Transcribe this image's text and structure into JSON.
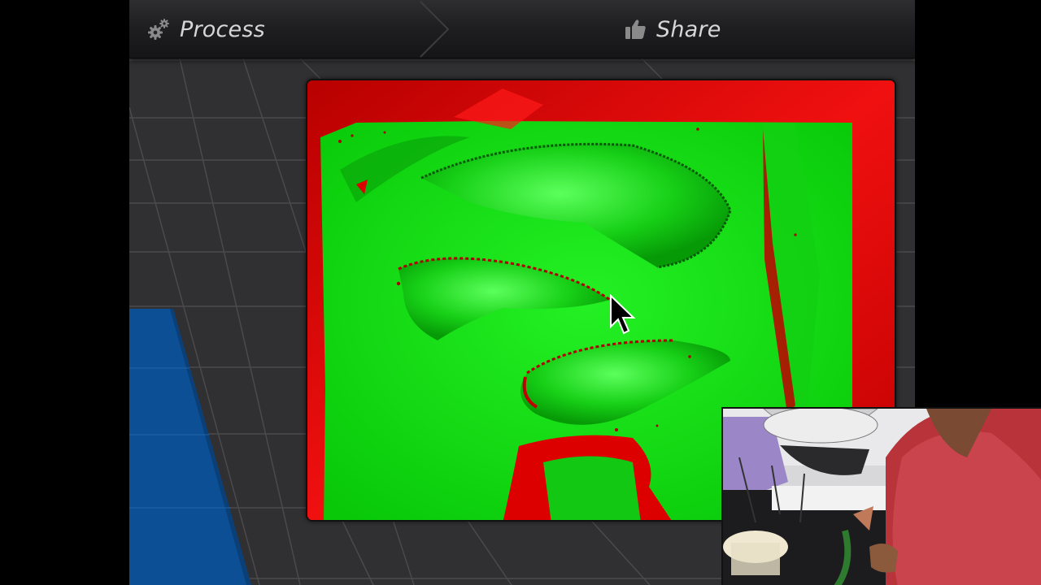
{
  "toolbar": {
    "process_label": "Process",
    "share_label": "Share",
    "process_icon": "gears-icon",
    "share_icon": "thumbs-up-icon"
  },
  "scan": {
    "icon": "deviation-map",
    "colors": {
      "in_tolerance": "#00e000",
      "out_of_tolerance": "#dd0000"
    }
  },
  "webcam": {
    "icon": "webcam-overlay"
  },
  "colors": {
    "background": "#000000",
    "app_background": "#2f2f31",
    "toolbar_text": "#d6d6d6",
    "blue_panel": "#0d4f94"
  }
}
